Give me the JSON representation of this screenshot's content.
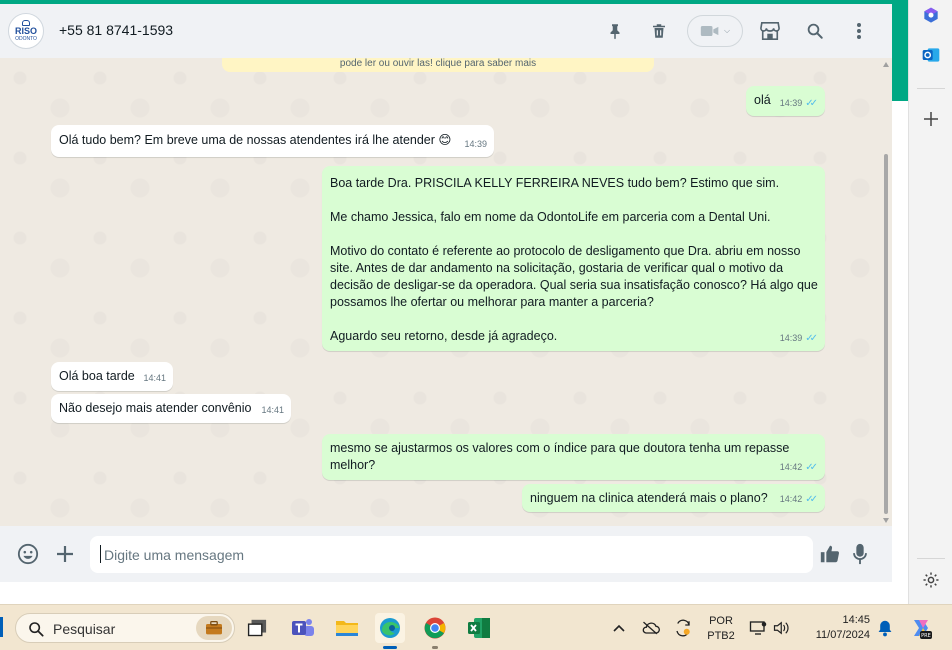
{
  "chat": {
    "contact": "+55 81 8741-1593",
    "avatar_logo": {
      "top": "RISO",
      "bottom": "ODONTO"
    },
    "system_notice": "pode ler ou ouvir las! clique para saber mais",
    "messages": [
      {
        "dir": "out",
        "text": "olá",
        "time": "14:39"
      },
      {
        "dir": "in",
        "text": "Olá tudo bem? Em breve uma de nossas atendentes irá lhe atender 😊",
        "time": "14:39"
      },
      {
        "dir": "out",
        "text": "Boa tarde Dra. PRISCILA KELLY FERREIRA NEVES tudo bem? Estimo que sim.\n\nMe chamo Jessica, falo em nome da OdontoLife em parceria com a Dental Uni.\n\nMotivo do contato é referente ao protocolo de desligamento que Dra. abriu em nosso site. Antes de dar andamento na solicitação, gostaria de verificar qual o motivo da decisão de desligar-se da operadora. Qual seria sua insatisfação conosco? Há algo que possamos lhe ofertar ou melhorar para manter a parceria?\n\nAguardo seu retorno, desde já agradeço.",
        "time": "14:39"
      },
      {
        "dir": "in",
        "text": "Olá boa tarde",
        "time": "14:41"
      },
      {
        "dir": "in",
        "text": "Não desejo mais atender convênio",
        "time": "14:41"
      },
      {
        "dir": "out",
        "text": "mesmo se ajustarmos os valores com o índice para que doutora tenha um repasse melhor?",
        "time": "14:42"
      },
      {
        "dir": "out",
        "text": "ninguem na clinica atenderá mais o plano?",
        "time": "14:42"
      }
    ]
  },
  "composer": {
    "placeholder": "Digite uma mensagem"
  },
  "taskbar": {
    "search_label": "Pesquisar",
    "language": {
      "line1": "POR",
      "line2": "PTB2"
    },
    "time": "14:45",
    "date": "11/07/2024",
    "copilot_badge": "PRE"
  },
  "colors": {
    "accent": "#00a884",
    "outgoing": "#d9fdd3",
    "incoming": "#ffffff",
    "read_ticks": "#53bdeb"
  }
}
